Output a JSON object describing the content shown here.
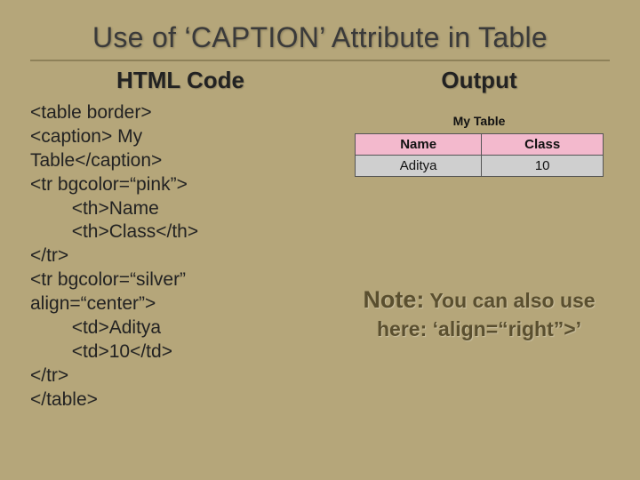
{
  "title": "Use of ‘CAPTION’ Attribute in Table",
  "left": {
    "heading": "HTML Code",
    "code": "<table border>\n<caption> My\nTable</caption>\n<tr bgcolor=“pink”>\n        <th>Name\n        <th>Class</th>\n</tr>\n<tr bgcolor=“silver”\nalign=“center”>\n        <td>Aditya\n        <td>10</td>\n</tr>\n</table>"
  },
  "right": {
    "heading": "Output",
    "table": {
      "caption": "My Table",
      "headers": [
        "Name",
        "Class"
      ],
      "row": [
        "Aditya",
        "10"
      ]
    },
    "note": {
      "lead": "Note:",
      "body1": " You can also use",
      "body2": "here: ‘align=“right”>’"
    }
  }
}
